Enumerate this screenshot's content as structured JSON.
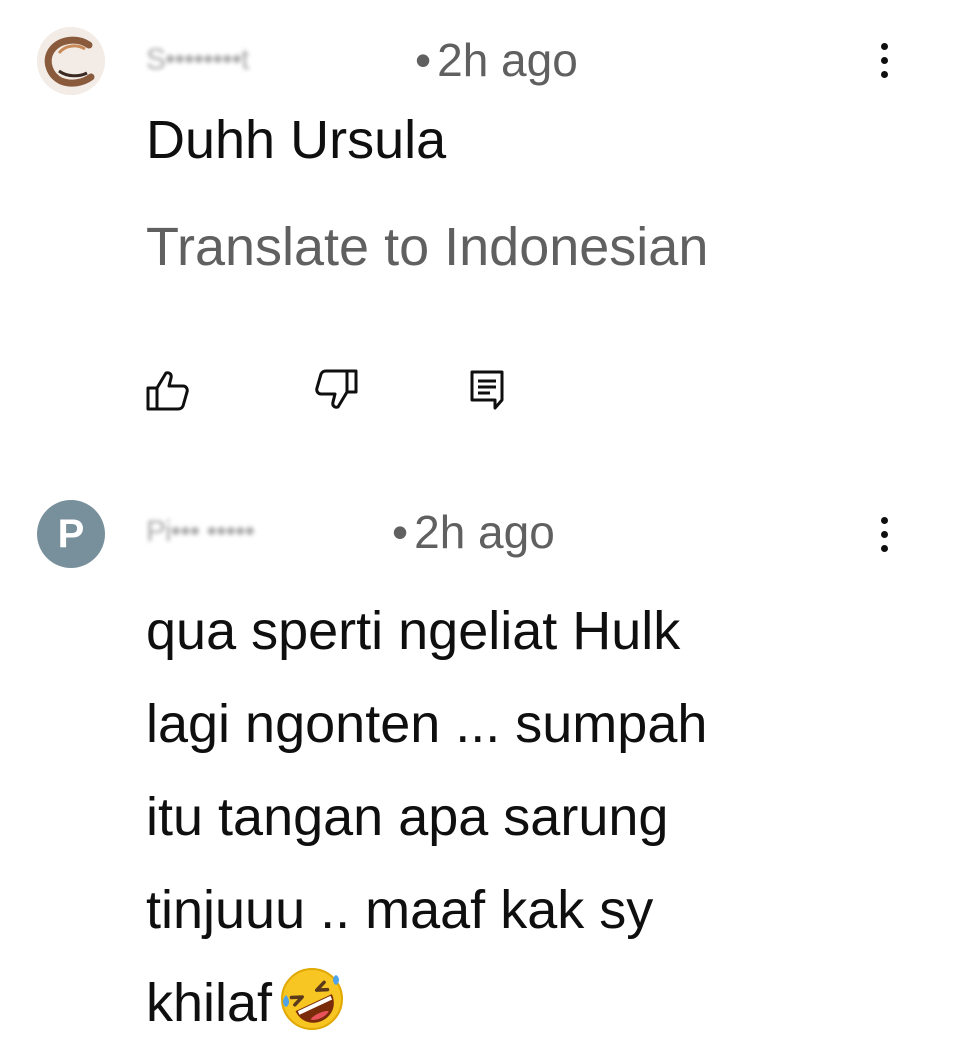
{
  "comments": [
    {
      "author": "S••••••••t",
      "separator": "•",
      "time": "2h ago",
      "text": "Duhh Ursula",
      "translate_label": "Translate to Indonesian",
      "avatar_letter": "",
      "avatar_color": "#f3ece6",
      "actions": {
        "like_icon": "thumb-up-icon",
        "dislike_icon": "thumb-down-icon",
        "reply_icon": "comment-reply-icon"
      }
    },
    {
      "author": "Pi••• •••••",
      "separator": "•",
      "time": "2h ago",
      "text_lines": [
        "qua sperti ngeliat Hulk",
        "lagi ngonten ... sumpah",
        "itu tangan apa sarung",
        "tinjuuu .. maaf kak sy",
        "khilaf"
      ],
      "emoji": "rolling-on-floor-laughing-emoji",
      "avatar_letter": "P",
      "avatar_color": "#78909c"
    }
  ],
  "menu_icon": "more-vertical-icon",
  "colors": {
    "primary_text": "#0f0f0f",
    "secondary_text": "#606060",
    "background": "#ffffff"
  }
}
